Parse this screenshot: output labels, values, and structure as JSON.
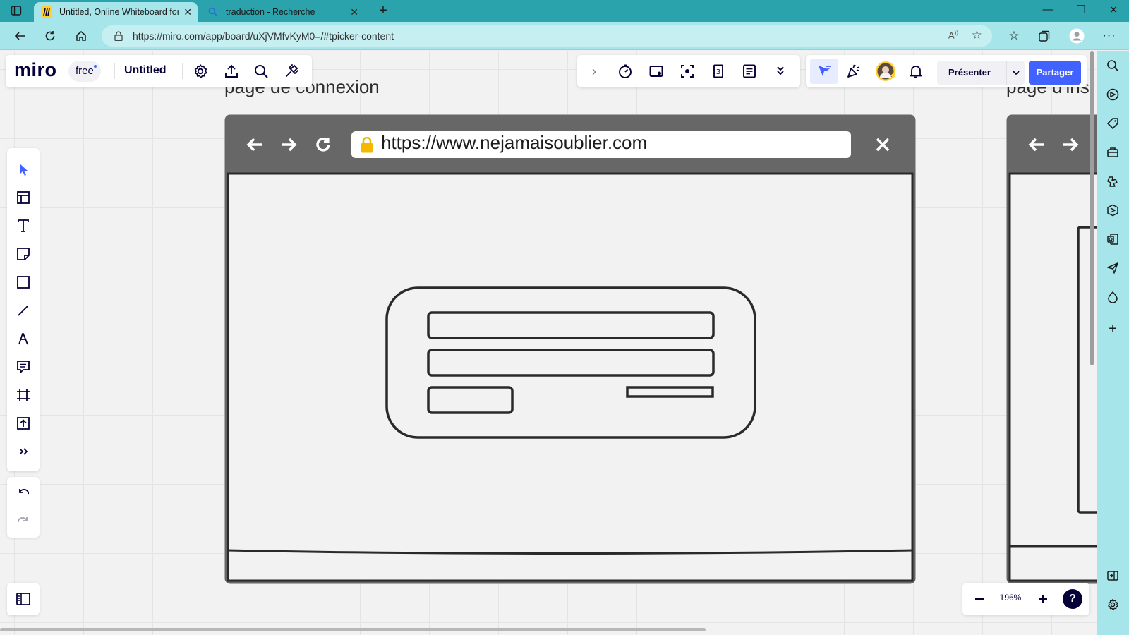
{
  "browser": {
    "tabs": [
      {
        "title": "Untitled, Online Whiteboard for ",
        "active": true
      },
      {
        "title": "traduction - Recherche",
        "active": false
      }
    ],
    "url": "https://miro.com/app/board/uXjVMfvKyM0=/#tpicker-content",
    "window_controls": [
      "minimize",
      "maximize",
      "close"
    ]
  },
  "miro": {
    "logo": "miro",
    "plan_badge": "free",
    "board_name": "Untitled",
    "top_right": {
      "present_label": "Présenter",
      "share_label": "Partager"
    },
    "zoom": "196%",
    "help": "?"
  },
  "canvas": {
    "frame_titles": [
      "page de connexion",
      "page d'ins"
    ],
    "wireframe_url": "https://www.nejamaisoublier.com"
  },
  "colors": {
    "browser_accent": "#2aa3ad",
    "browser_toolbar": "#a6e6eb",
    "miro_blue": "#4262ff",
    "wire_bar": "#676767"
  }
}
